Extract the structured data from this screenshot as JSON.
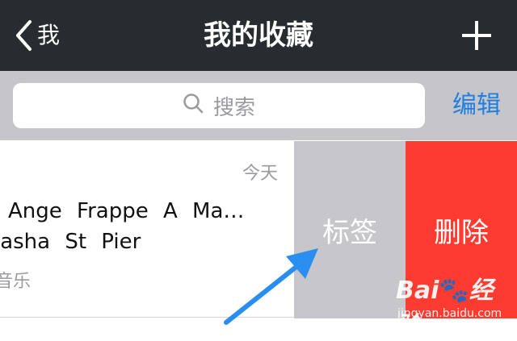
{
  "navbar": {
    "back_label": "我",
    "title": "我的收藏"
  },
  "search": {
    "placeholder": "搜索",
    "edit_label": "编辑"
  },
  "row": {
    "date": "今天",
    "line1": "Ange Frappe A Ma…",
    "line2": "tasha St Pier",
    "category": "音乐",
    "tag_action": "标签",
    "delete_action": "删除"
  },
  "watermark": {
    "brand": "Bai",
    "brand_suffix": "经验",
    "url": "jingyan.baidu.com"
  },
  "colors": {
    "navbar": "#262c2f",
    "searchbar": "#c6c6ca",
    "accent": "#1f7fe0",
    "tag_action": "#c6c6cb",
    "delete_action": "#fe3b30",
    "arrow": "#2a8ef0"
  },
  "icons": [
    "chevron-left-icon",
    "plus-icon",
    "search-icon",
    "arrow-annotation-icon",
    "baidu-paw-icon"
  ]
}
